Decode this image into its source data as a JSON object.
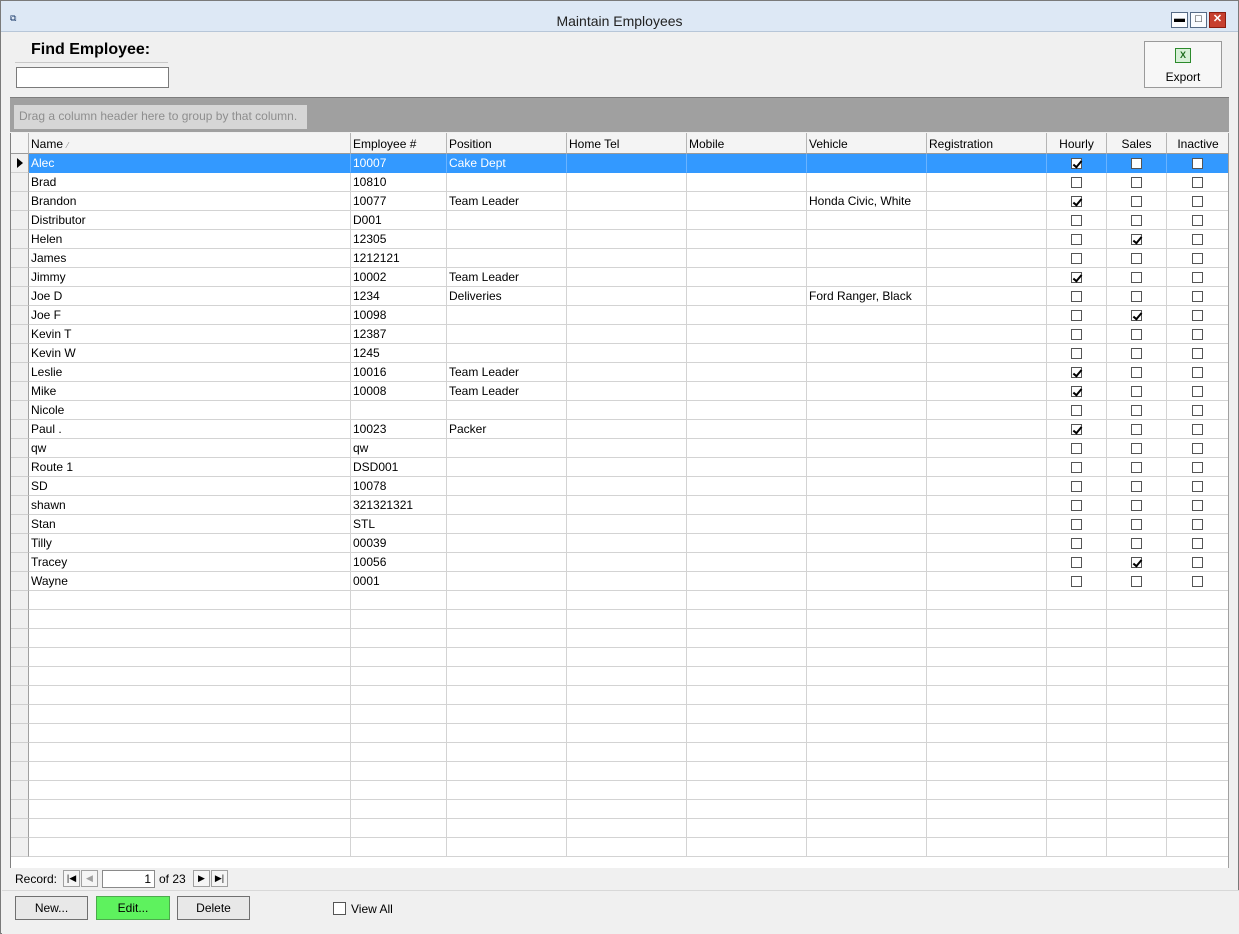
{
  "window": {
    "title": "Maintain Employees",
    "minimize_glyph": "▬",
    "maximize_glyph": "□",
    "close_glyph": "✕",
    "app_icon": "window-app-icon"
  },
  "find": {
    "label": "Find Employee:",
    "value": ""
  },
  "export": {
    "label": "Export",
    "icon": "excel-export-icon"
  },
  "group_hint": "Drag a column header here to group by that column.",
  "grid": {
    "columns": [
      "Name",
      "Employee #",
      "Position",
      "Home Tel",
      "Mobile",
      "Vehicle",
      "Registration",
      "Hourly",
      "Sales",
      "Inactive"
    ],
    "sort_column": "Name",
    "sort_direction": "ascending",
    "selected_row": 0,
    "rows": [
      {
        "name": "Alec",
        "emp": "10007",
        "position": "Cake Dept",
        "home": "",
        "mobile": "",
        "vehicle": "",
        "reg": "",
        "hourly": true,
        "sales": false,
        "inactive": false
      },
      {
        "name": "Brad",
        "emp": "10810",
        "position": "",
        "home": "",
        "mobile": "",
        "vehicle": "",
        "reg": "",
        "hourly": false,
        "sales": false,
        "inactive": false
      },
      {
        "name": "Brandon",
        "emp": "10077",
        "position": "Team Leader",
        "home": "",
        "mobile": "",
        "vehicle": "Honda Civic, White",
        "reg": "",
        "hourly": true,
        "sales": false,
        "inactive": false
      },
      {
        "name": "Distributor",
        "emp": "D001",
        "position": "",
        "home": "",
        "mobile": "",
        "vehicle": "",
        "reg": "",
        "hourly": false,
        "sales": false,
        "inactive": false
      },
      {
        "name": "Helen",
        "emp": "12305",
        "position": "",
        "home": "",
        "mobile": "",
        "vehicle": "",
        "reg": "",
        "hourly": false,
        "sales": true,
        "inactive": false
      },
      {
        "name": "James",
        "emp": "1212121",
        "position": "",
        "home": "",
        "mobile": "",
        "vehicle": "",
        "reg": "",
        "hourly": false,
        "sales": false,
        "inactive": false
      },
      {
        "name": "Jimmy",
        "emp": "10002",
        "position": "Team Leader",
        "home": "",
        "mobile": "",
        "vehicle": "",
        "reg": "",
        "hourly": true,
        "sales": false,
        "inactive": false
      },
      {
        "name": "Joe D",
        "emp": "1234",
        "position": "Deliveries",
        "home": "",
        "mobile": "",
        "vehicle": "Ford Ranger, Black",
        "reg": "",
        "hourly": false,
        "sales": false,
        "inactive": false
      },
      {
        "name": "Joe F",
        "emp": "10098",
        "position": "",
        "home": "",
        "mobile": "",
        "vehicle": "",
        "reg": "",
        "hourly": false,
        "sales": true,
        "inactive": false
      },
      {
        "name": "Kevin T",
        "emp": "12387",
        "position": "",
        "home": "",
        "mobile": "",
        "vehicle": "",
        "reg": "",
        "hourly": false,
        "sales": false,
        "inactive": false
      },
      {
        "name": "Kevin W",
        "emp": "1245",
        "position": "",
        "home": "",
        "mobile": "",
        "vehicle": "",
        "reg": "",
        "hourly": false,
        "sales": false,
        "inactive": false
      },
      {
        "name": "Leslie",
        "emp": "10016",
        "position": "Team Leader",
        "home": "",
        "mobile": "",
        "vehicle": "",
        "reg": "",
        "hourly": true,
        "sales": false,
        "inactive": false
      },
      {
        "name": "Mike",
        "emp": "10008",
        "position": "Team Leader",
        "home": "",
        "mobile": "",
        "vehicle": "",
        "reg": "",
        "hourly": true,
        "sales": false,
        "inactive": false
      },
      {
        "name": "Nicole",
        "emp": "",
        "position": "",
        "home": "",
        "mobile": "",
        "vehicle": "",
        "reg": "",
        "hourly": false,
        "sales": false,
        "inactive": false
      },
      {
        "name": "Paul .",
        "emp": "10023",
        "position": "Packer",
        "home": "",
        "mobile": "",
        "vehicle": "",
        "reg": "",
        "hourly": true,
        "sales": false,
        "inactive": false
      },
      {
        "name": "qw",
        "emp": "qw",
        "position": "",
        "home": "",
        "mobile": "",
        "vehicle": "",
        "reg": "",
        "hourly": false,
        "sales": false,
        "inactive": false
      },
      {
        "name": "Route 1",
        "emp": "DSD001",
        "position": "",
        "home": "",
        "mobile": "",
        "vehicle": "",
        "reg": "",
        "hourly": false,
        "sales": false,
        "inactive": false
      },
      {
        "name": "SD",
        "emp": "10078",
        "position": "",
        "home": "",
        "mobile": "",
        "vehicle": "",
        "reg": "",
        "hourly": false,
        "sales": false,
        "inactive": false
      },
      {
        "name": "shawn",
        "emp": "321321321",
        "position": "",
        "home": "",
        "mobile": "",
        "vehicle": "",
        "reg": "",
        "hourly": false,
        "sales": false,
        "inactive": false
      },
      {
        "name": "Stan",
        "emp": "STL",
        "position": "",
        "home": "",
        "mobile": "",
        "vehicle": "",
        "reg": "",
        "hourly": false,
        "sales": false,
        "inactive": false
      },
      {
        "name": "Tilly",
        "emp": "00039",
        "position": "",
        "home": "",
        "mobile": "",
        "vehicle": "",
        "reg": "",
        "hourly": false,
        "sales": false,
        "inactive": false
      },
      {
        "name": "Tracey",
        "emp": "10056",
        "position": "",
        "home": "",
        "mobile": "",
        "vehicle": "",
        "reg": "",
        "hourly": false,
        "sales": true,
        "inactive": false
      },
      {
        "name": "Wayne",
        "emp": "0001",
        "position": "",
        "home": "",
        "mobile": "",
        "vehicle": "",
        "reg": "",
        "hourly": false,
        "sales": false,
        "inactive": false
      }
    ]
  },
  "nav": {
    "label": "Record:",
    "current": "1",
    "of_text": "of 23",
    "first_glyph": "|◀",
    "prev_glyph": "◀",
    "next_glyph": "▶",
    "last_glyph": "▶|"
  },
  "buttons": {
    "new_label": "New...",
    "edit_label": "Edit...",
    "delete_label": "Delete"
  },
  "view_all": {
    "label": "View All",
    "checked": false
  },
  "colors": {
    "selection": "#3399ff",
    "edit_button": "#5ef25e",
    "title_bar": "#dde8f5"
  }
}
